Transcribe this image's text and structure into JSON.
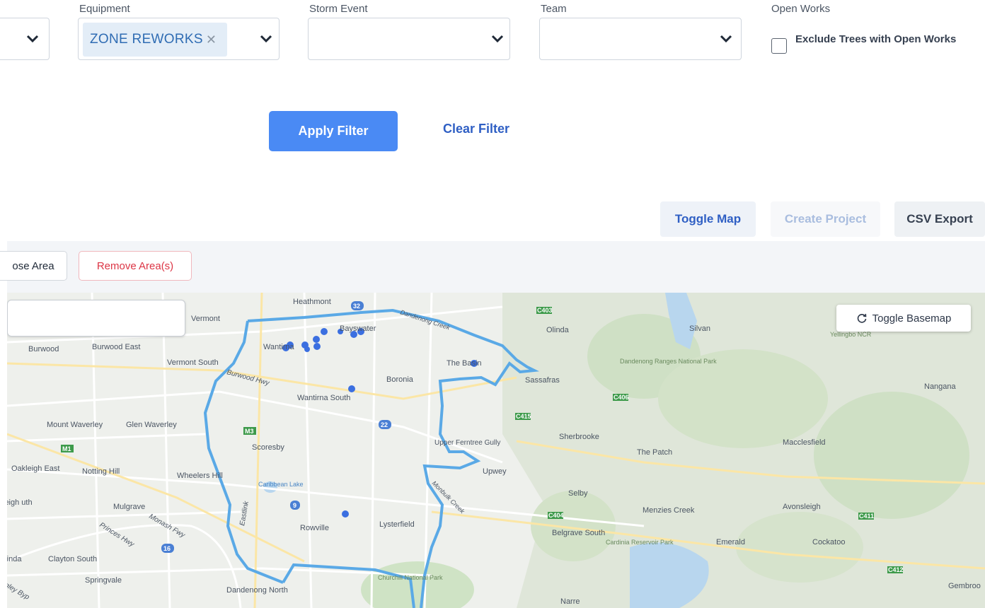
{
  "filters": {
    "equipment": {
      "label": "Equipment",
      "chip": "ZONE REWORKS"
    },
    "storm_event": {
      "label": "Storm Event",
      "value": ""
    },
    "team": {
      "label": "Team",
      "value": ""
    },
    "open_works": {
      "label": "Open Works",
      "checkbox_label": "Exclude Trees with Open Works",
      "checked": false
    }
  },
  "actions": {
    "apply": "Apply Filter",
    "clear": "Clear Filter"
  },
  "toolbar": {
    "toggle_map": "Toggle Map",
    "create_project": "Create Project",
    "csv_export": "CSV Export"
  },
  "area": {
    "choose": "ose Area",
    "remove": "Remove Area(s)"
  },
  "map": {
    "basemap_button": "Toggle Basemap",
    "places": [
      "Heathmont",
      "Vermont",
      "Bayswater",
      "Olinda",
      "Silvan",
      "Yellingbo NCR",
      "Burwood",
      "Burwood East",
      "Wantirna",
      "Vermont South",
      "The Basin",
      "Sassafras",
      "Dandenong Ranges National Park",
      "Nangana",
      "Boronia",
      "Wantirna South",
      "Mount Waverley",
      "Glen Waverley",
      "Scoresby",
      "Sherbrooke",
      "Upper Ferntree Gully",
      "The Patch",
      "Macclesfield",
      "Oakleigh East",
      "Notting Hill",
      "Wheelers Hill",
      "Upwey",
      "Caribbean Lake",
      "Selby",
      "Mulgrave",
      "Menzies Creek",
      "Avonsleigh",
      "Rowville",
      "Lysterfield",
      "Belgrave South",
      "Cardinia Reservoir Park",
      "Emerald",
      "Cockatoo",
      "Clayton South",
      "Springvale",
      "Churchill National Park",
      "Dandenong North",
      "Narre",
      "Gembroo",
      "Burwood Hwy",
      "Monash Fwy",
      "Princes Hwy",
      "Eastlink",
      "Monbulk Creek",
      "Dandenong Creek",
      "leigh uth",
      "rinda",
      "gley Byp"
    ],
    "road_shields": [
      "32",
      "22",
      "9",
      "16",
      "M3",
      "M1",
      "C403",
      "C406",
      "C415",
      "C404",
      "C411",
      "C412"
    ]
  },
  "colors": {
    "accent": "#4a8af4",
    "link": "#2f5fc4",
    "remove": "#dc3545",
    "boundary": "#5aa9e6",
    "points": "#3b6fe0"
  }
}
